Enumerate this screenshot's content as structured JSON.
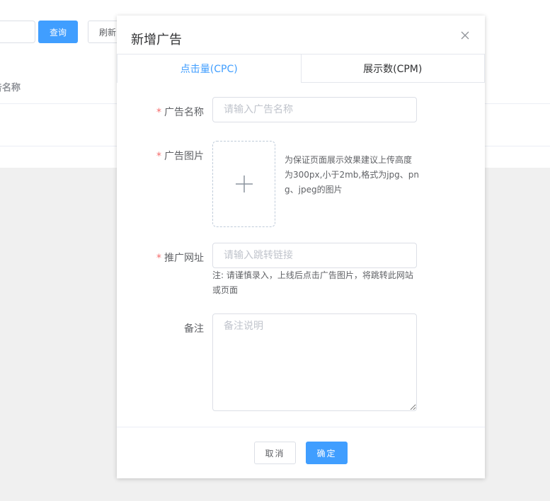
{
  "background": {
    "query_button": "查询",
    "refresh_button": "刷新",
    "column_header": "告名称"
  },
  "dialog": {
    "title": "新增广告",
    "tabs": [
      {
        "label": "点击量(CPC)",
        "active": true
      },
      {
        "label": "展示数(CPM)",
        "active": false
      }
    ],
    "fields": {
      "ad_name": {
        "label": "广告名称",
        "placeholder": "请输入广告名称",
        "required": true
      },
      "ad_image": {
        "label": "广告图片",
        "required": true,
        "hint_lines": [
          "为保证页面展示效果建议上传高度",
          "为300px,小于2mb,格式为jpg、pn",
          "g、jpeg的图片"
        ]
      },
      "promo_url": {
        "label": "推广网址",
        "placeholder": "请输入跳转链接",
        "required": true,
        "note_lines": [
          "注: 请谨慎录入，上线后点击广告图片，将跳转此网站",
          "或页面"
        ]
      },
      "remark": {
        "label": "备注",
        "placeholder": "备注说明",
        "required": false
      }
    },
    "required_mark": "*",
    "cancel_button": "取消",
    "confirm_button": "确定"
  },
  "colors": {
    "primary": "#409eff",
    "required": "#f56c6c",
    "border": "#dcdfe6",
    "placeholder": "#c0c4cc",
    "background": "#f0f0f0"
  }
}
